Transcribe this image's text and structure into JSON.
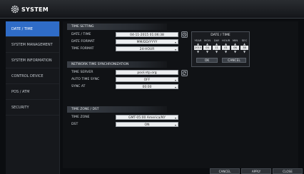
{
  "app": {
    "title": "SYSTEM"
  },
  "sidebar": {
    "items": [
      {
        "label": "DATE / TIME",
        "active": true
      },
      {
        "label": "SYSTEM MANAGEMENT",
        "active": false
      },
      {
        "label": "SYSTEM INFORMATION",
        "active": false
      },
      {
        "label": "CONTROL DEVICE",
        "active": false
      },
      {
        "label": "POS / ATM",
        "active": false
      },
      {
        "label": "SECURITY",
        "active": false
      }
    ]
  },
  "time_setting": {
    "header": "TIME SETTING",
    "rows": [
      {
        "label": "DATE / TIME",
        "value": "04-11-2015 01:06:38"
      },
      {
        "label": "DATE FORMAT",
        "value": "MM/DD/YYYY"
      },
      {
        "label": "TIME FORMAT",
        "value": "24-HOUR"
      }
    ]
  },
  "network_sync": {
    "header": "NETWORK TIME SYNCHRONIZATION",
    "rows": [
      {
        "label": "TIME SERVER",
        "value": "pool.ntp.org"
      },
      {
        "label": "AUTO TIME SYNC",
        "value": "OFF"
      },
      {
        "label": "SYNC AT",
        "value": "00:00"
      }
    ]
  },
  "timezone": {
    "header": "TIME ZONE / DST",
    "rows": [
      {
        "label": "TIME ZONE",
        "value": "GMT-05:00 America/NY"
      },
      {
        "label": "DST",
        "value": "ON"
      }
    ]
  },
  "popup": {
    "title": "DATE / TIME",
    "columns": [
      {
        "header": "YEAR",
        "value": "2015"
      },
      {
        "header": "MON",
        "value": "04"
      },
      {
        "header": "DAY",
        "value": "11"
      },
      {
        "header": "HOUR",
        "value": "01"
      },
      {
        "header": "MIN",
        "value": "06"
      },
      {
        "header": "SEC",
        "value": "38"
      }
    ],
    "ok_label": "OK",
    "cancel_label": "CANCEL"
  },
  "footer": {
    "cancel_label": "CANCEL",
    "apply_label": "APPLY",
    "close_label": "CLOSE"
  }
}
